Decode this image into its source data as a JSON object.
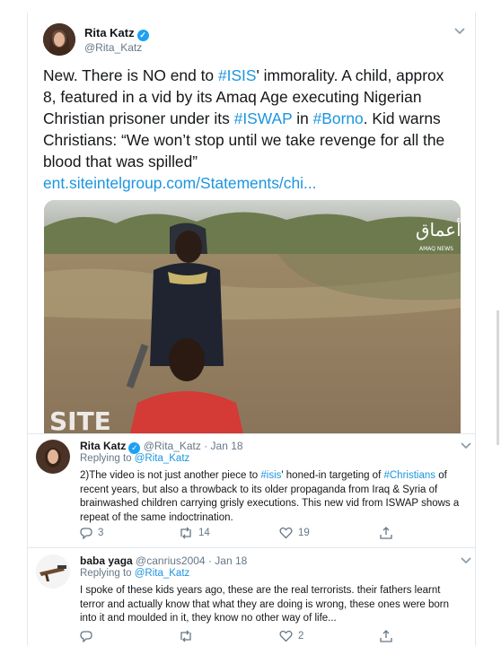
{
  "main_tweet": {
    "author_name": "Rita Katz",
    "handle": "@Rita_Katz",
    "text_before_1": "New. There is NO end to ",
    "hashtag_1": "#ISIS",
    "text_before_2": "' immorality. A child, approx 8, featured in a vid by its Amaq Age executing Nigerian Christian prisoner under its ",
    "hashtag_2": "#ISWAP",
    "text_before_3": " in ",
    "hashtag_3": "#Borno",
    "text_before_4": ". Kid warns Christians: “We won’t stop until we take revenge for all the blood that was spilled”",
    "link": "ent.siteintelgroup.com/Statements/chi...",
    "media_watermark": "AMAQ NEWS",
    "media_watermark_arabic": "أعماق",
    "media_corner_logo": "SITE"
  },
  "replies": [
    {
      "author_name": "Rita Katz",
      "handle_date": "@Rita_Katz · Jan 18",
      "replying_to_prefix": "Replying to ",
      "replying_to": "@Rita_Katz",
      "text_1": "2)The video is not just another piece to ",
      "tag_1": "#isis",
      "text_2": "' honed-in targeting of ",
      "tag_2": "#Christians",
      "text_3": " of recent years, but also a throwback to its older propaganda from Iraq & Syria of brainwashed children carrying grisly executions. This new vid from ISWAP shows a repeat of the same indoctrination.",
      "reply_count": "3",
      "retweet_count": "14",
      "like_count": "19"
    },
    {
      "author_name": "baba yaga",
      "handle_date": "@canrius2004 · Jan 18",
      "replying_to_prefix": "Replying to ",
      "replying_to": "@Rita_Katz",
      "text": "I spoke of these kids years ago, these are the real terrorists.  their fathers learnt terror and actually know that what they are doing is wrong, these ones were born into it and moulded in it, they know no other way of life...",
      "reply_count": "",
      "retweet_count": "",
      "like_count": "2"
    }
  ],
  "colors": {
    "accent": "#1b95e0",
    "verified": "#1da1f2",
    "muted": "#657786"
  }
}
